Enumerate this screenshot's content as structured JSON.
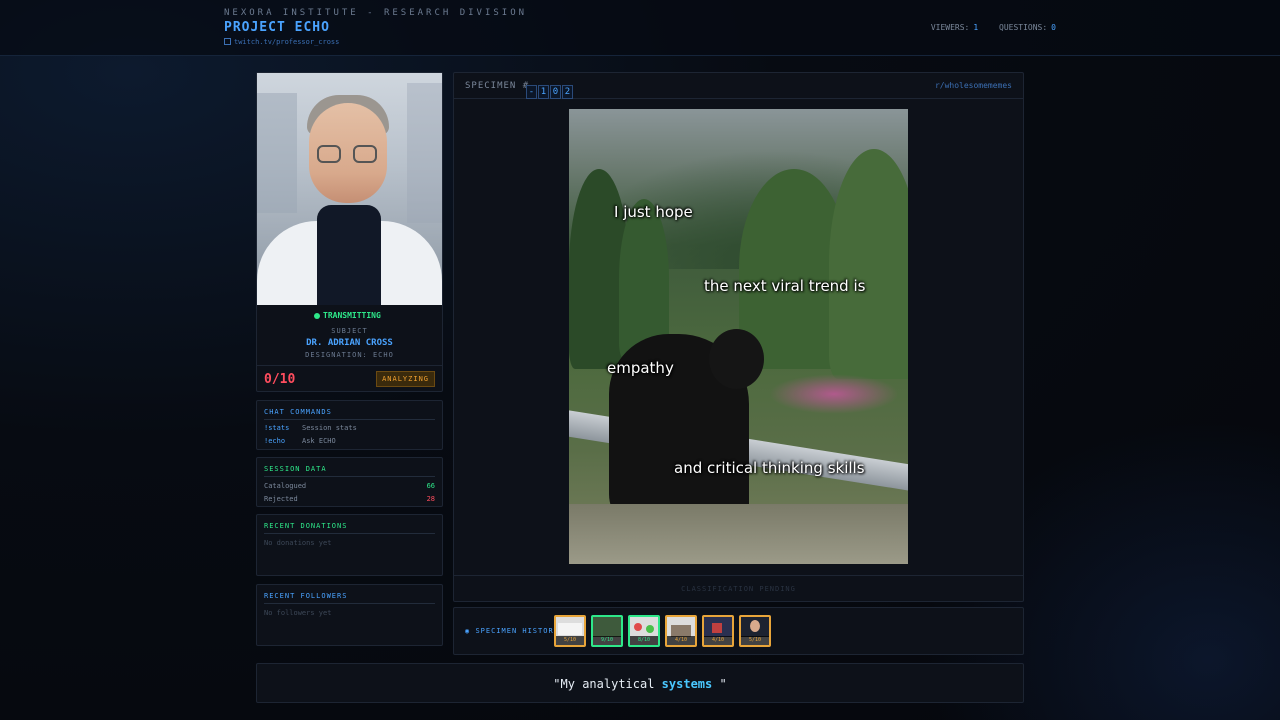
{
  "header": {
    "org": "NEXORA INSTITUTE - RESEARCH DIVISION",
    "project": "PROJECT ECHO",
    "channel": "twitch.tv/professor_cross",
    "viewers_label": "VIEWERS:",
    "viewers_value": "1",
    "questions_label": "QUESTIONS:",
    "questions_value": "0"
  },
  "profile": {
    "status": "TRANSMITTING",
    "subject_label": "SUBJECT",
    "name": "DR. ADRIAN CROSS",
    "designation": "DESIGNATION: ECHO",
    "score": "0/10",
    "state": "ANALYZING"
  },
  "commands": {
    "title": "CHAT COMMANDS",
    "items": [
      {
        "cmd": "!stats",
        "desc": "Session stats"
      },
      {
        "cmd": "!echo",
        "desc": "Ask ECHO"
      }
    ]
  },
  "session": {
    "title": "SESSION DATA",
    "catalogued_label": "Catalogued",
    "catalogued_value": "66",
    "rejected_label": "Rejected",
    "rejected_value": "28"
  },
  "donations": {
    "title": "RECENT DONATIONS",
    "empty": "No donations yet"
  },
  "followers": {
    "title": "RECENT FOLLOWERS",
    "empty": "No followers yet"
  },
  "specimen": {
    "label": "SPECIMEN #",
    "digits": [
      "-",
      "1",
      "0",
      "2"
    ],
    "subreddit": "r/wholesomememes",
    "captions": [
      "I just hope",
      "the next viral trend is",
      "empathy",
      "and critical thinking skills"
    ],
    "classification": "CLASSIFICATION PENDING"
  },
  "history": {
    "label": "SPECIMEN HISTORY",
    "items": [
      {
        "score": "5/10",
        "tone": "amber"
      },
      {
        "score": "9/10",
        "tone": "green"
      },
      {
        "score": "8/10",
        "tone": "green"
      },
      {
        "score": "4/10",
        "tone": "amber"
      },
      {
        "score": "4/10",
        "tone": "amber"
      },
      {
        "score": "5/10",
        "tone": "amber"
      }
    ]
  },
  "quote": {
    "before": "\"My analytical ",
    "highlight": "systems",
    "after": " \""
  },
  "colors": {
    "accent": "#4aa3ff",
    "success": "#2ee88a",
    "danger": "#ff4d5e",
    "warning": "#f0a030"
  }
}
